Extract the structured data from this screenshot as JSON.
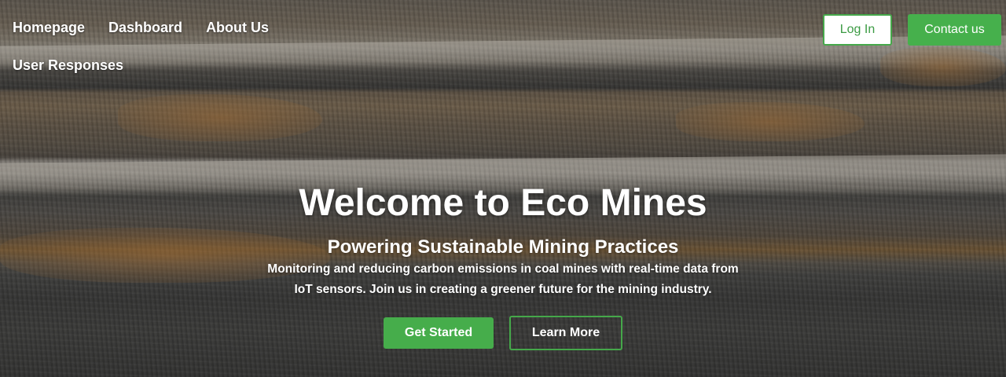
{
  "nav": {
    "links": [
      "Homepage",
      "Dashboard",
      "About Us",
      "User Responses"
    ]
  },
  "header_buttons": {
    "login": "Log In",
    "contact": "Contact us"
  },
  "hero": {
    "title": "Welcome to Eco Mines",
    "subtitle": "Powering Sustainable Mining Practices",
    "description": "Monitoring and reducing carbon emissions in coal mines with real-time data from IoT sensors. Join us in creating a greener future for the mining industry.",
    "primary_button": "Get Started",
    "secondary_button": "Learn More"
  },
  "colors": {
    "accent": "#46b04c",
    "text": "#ffffff"
  }
}
